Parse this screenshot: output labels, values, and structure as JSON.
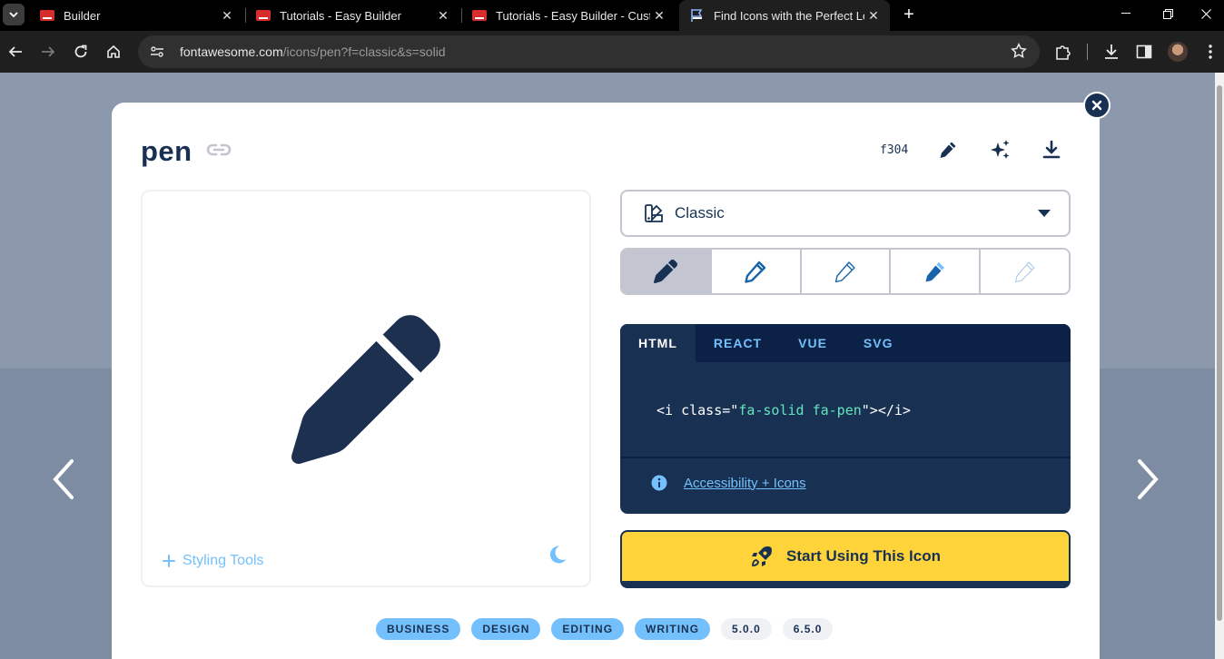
{
  "browser": {
    "tabs": [
      {
        "title": "Builder"
      },
      {
        "title": "Tutorials - Easy Builder"
      },
      {
        "title": "Tutorials - Easy Builder - Custom"
      },
      {
        "title": "Find Icons with the Perfect Look"
      }
    ],
    "url_host": "fontawesome.com",
    "url_path": "/icons/pen?f=classic&s=solid"
  },
  "modal": {
    "icon_name": "pen",
    "unicode": "f304",
    "family": {
      "label": "Classic"
    },
    "code_tabs": [
      "HTML",
      "REACT",
      "VUE",
      "SVG"
    ],
    "code": {
      "prefix": "<i class=\"",
      "value": "fa-solid fa-pen",
      "suffix": "\"></i>"
    },
    "accessibility_link": "Accessibility + Icons",
    "start_button": "Start Using This Icon",
    "styling_tools": "Styling Tools",
    "tags": [
      "BUSINESS",
      "DESIGN",
      "EDITING",
      "WRITING"
    ],
    "versions": [
      "5.0.0",
      "6.5.0"
    ]
  },
  "colors": {
    "navy": "#183153",
    "accent_blue": "#74c0fc",
    "yellow": "#ffd43b"
  }
}
